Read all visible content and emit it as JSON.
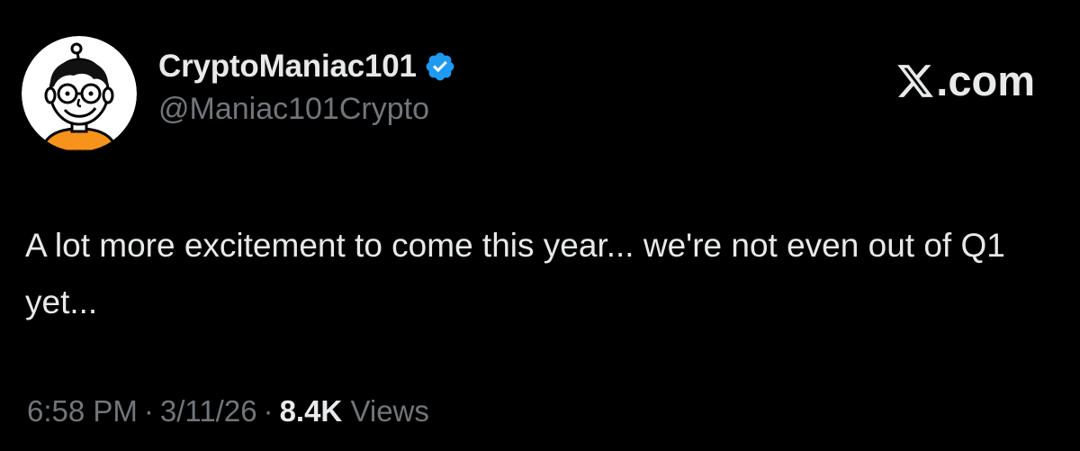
{
  "author": {
    "display_name": "CryptoManiac101",
    "handle": "@Maniac101Crypto",
    "verified": true
  },
  "brand": {
    "suffix": ".com"
  },
  "tweet": {
    "text": "A lot more excitement to come this year... we're not even out of Q1 yet..."
  },
  "meta": {
    "time": "6:58 PM",
    "separator": "·",
    "date": "3/11/26",
    "views_count": "8.4K",
    "views_label": "Views"
  },
  "colors": {
    "background": "#000000",
    "primary_text": "#e7e9ea",
    "secondary_text": "#71767b",
    "verified_blue": "#1d9bf0",
    "avatar_shirt": "#f7931a"
  },
  "icons": {
    "verified": "verified-badge-icon",
    "brand_logo": "x-logo-icon"
  }
}
